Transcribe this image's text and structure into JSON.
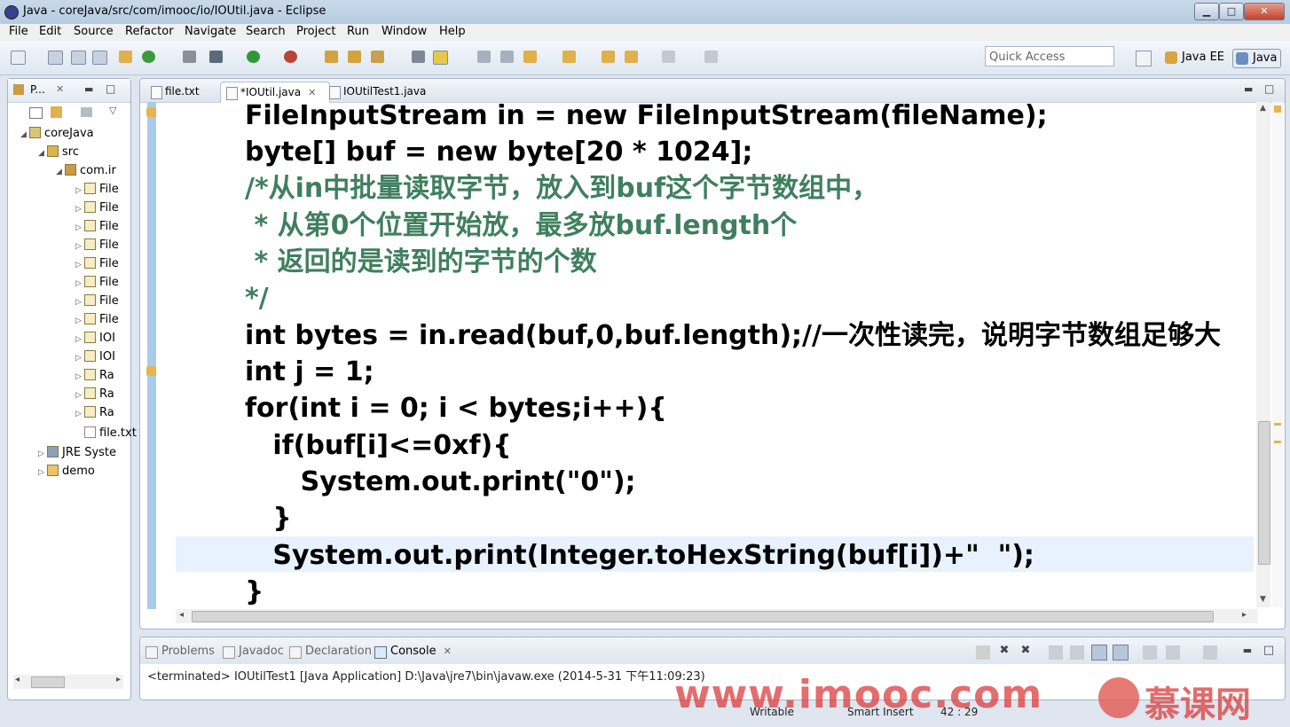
{
  "window": {
    "title": "Java - coreJava/src/com/imooc/io/IOUtil.java - Eclipse",
    "minimize": "▁",
    "maximize": "□",
    "close": "✕"
  },
  "menu": [
    "File",
    "Edit",
    "Source",
    "Refactor",
    "Navigate",
    "Search",
    "Project",
    "Run",
    "Window",
    "Help"
  ],
  "toolbar": {
    "quick_access_placeholder": "Quick Access",
    "perspectives": [
      "Java EE",
      "Java"
    ]
  },
  "explorer": {
    "tab_label": "P...",
    "tree": [
      {
        "label": "coreJava",
        "icon": "project-icon"
      },
      {
        "label": "src",
        "icon": "source-folder-icon"
      },
      {
        "label": "com.ir",
        "icon": "package-icon"
      },
      {
        "label": "File",
        "icon": "java-file-icon"
      },
      {
        "label": "File",
        "icon": "java-file-icon"
      },
      {
        "label": "File",
        "icon": "java-file-icon"
      },
      {
        "label": "File",
        "icon": "java-file-icon"
      },
      {
        "label": "File",
        "icon": "java-file-icon"
      },
      {
        "label": "File",
        "icon": "java-file-icon"
      },
      {
        "label": "File",
        "icon": "java-file-icon"
      },
      {
        "label": "File",
        "icon": "java-file-icon"
      },
      {
        "label": "IOI",
        "icon": "java-file-icon"
      },
      {
        "label": "IOI",
        "icon": "java-file-icon"
      },
      {
        "label": "Ra",
        "icon": "java-file-icon"
      },
      {
        "label": "Ra",
        "icon": "java-file-icon"
      },
      {
        "label": "Ra",
        "icon": "java-file-icon"
      },
      {
        "label": "file.txt",
        "icon": "text-file-icon"
      },
      {
        "label": "JRE Syste",
        "icon": "library-icon"
      },
      {
        "label": "demo",
        "icon": "folder-icon"
      }
    ]
  },
  "editor": {
    "tabs": [
      {
        "label": "file.txt",
        "active": false
      },
      {
        "label": "*IOUtil.java",
        "active": true
      },
      {
        "label": "IOUtilTest1.java",
        "active": false
      }
    ],
    "lines": [
      "FileInputStream in = new FileInputStream(fileName);",
      "byte[] buf = new byte[20 * 1024];",
      "/*从in中批量读取字节，放入到buf这个字节数组中，",
      " * 从第0个位置开始放，最多放buf.length个",
      " * 返回的是读到的字节的个数",
      "*/",
      "int bytes = in.read(buf,0,buf.length);//一次性读完，说明字节数组足够大",
      "int j = 1;",
      "for(int i = 0; i < bytes;i++){",
      "   if(buf[i]<=0xf){",
      "      System.out.print(\"0\");",
      "   }",
      "   System.out.print(Integer.toHexString(buf[i])+\"  \");",
      "}"
    ]
  },
  "console": {
    "tabs": [
      "Problems",
      "Javadoc",
      "Declaration",
      "Console"
    ],
    "status": "<terminated> IOUtilTest1 [Java Application] D:\\Java\\jre7\\bin\\javaw.exe (2014-5-31 下午11:09:23)"
  },
  "statusbar": {
    "writable": "Writable",
    "insert_mode": "Smart Insert",
    "position": "42 : 29"
  },
  "watermark": {
    "url": "www.imooc.com",
    "brand": "慕课网"
  }
}
